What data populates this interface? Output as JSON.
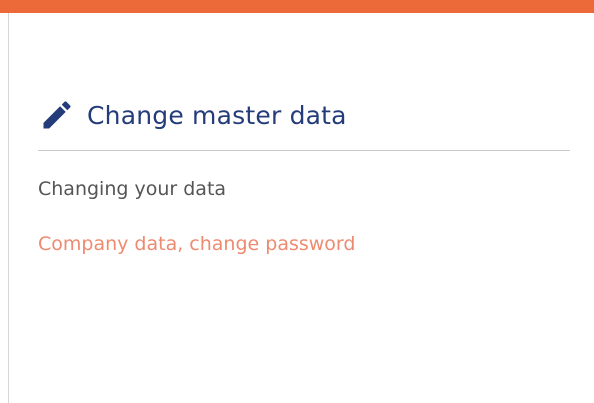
{
  "colors": {
    "accent_bar": "#ec6a3a",
    "title": "#243c7a",
    "link": "#ee8a70",
    "text": "#555555"
  },
  "header": {
    "icon": "pencil-icon",
    "title": "Change master data"
  },
  "content": {
    "subtitle": "Changing your data",
    "link_label": "Company data, change password"
  }
}
